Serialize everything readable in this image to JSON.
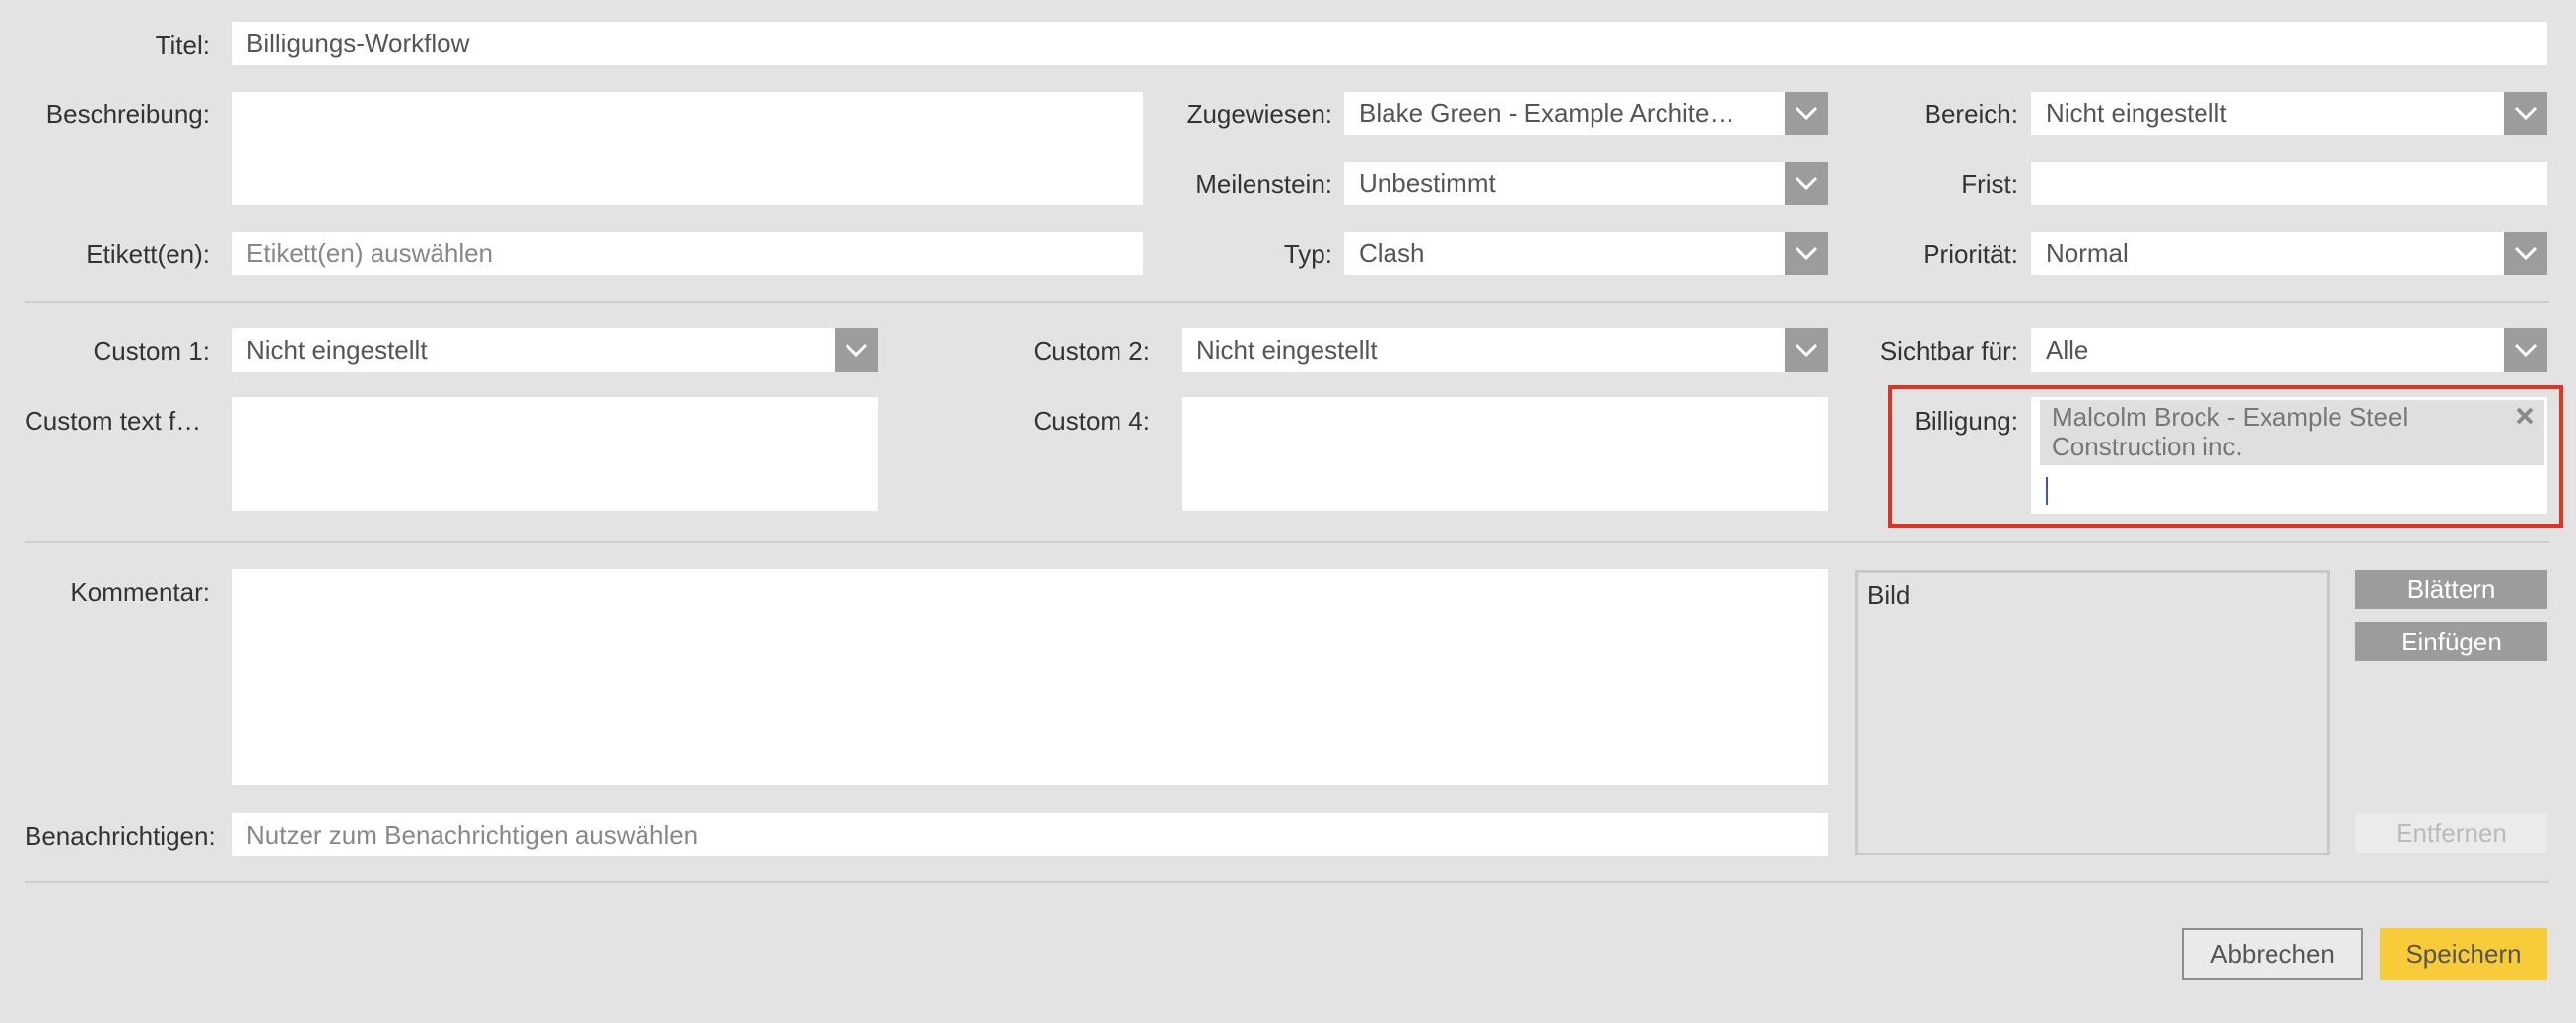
{
  "labels": {
    "title": "Titel:",
    "description": "Beschreibung:",
    "assigned": "Zugewiesen:",
    "area": "Bereich:",
    "milestone": "Meilenstein:",
    "deadline": "Frist:",
    "tags": "Etikett(en):",
    "type": "Typ:",
    "priority": "Priorität:",
    "custom1": "Custom 1:",
    "custom2": "Custom 2:",
    "visible_for": "Sichtbar für:",
    "custom_text": "Custom text f…",
    "custom4": "Custom 4:",
    "approval": "Billigung:",
    "comment": "Kommentar:",
    "notify": "Benachrichtigen:"
  },
  "fields": {
    "title_value": "Billigungs-Workflow",
    "assigned_value": "Blake Green - Example Archite…",
    "area_value": "Nicht eingestellt",
    "milestone_value": "Unbestimmt",
    "deadline_value": "",
    "tags_placeholder": "Etikett(en) auswählen",
    "type_value": "Clash",
    "priority_value": "Normal",
    "custom1_value": "Nicht eingestellt",
    "custom2_value": "Nicht eingestellt",
    "visible_for_value": "Alle",
    "approval_tag": "Malcolm Brock - Example Steel Construction inc.",
    "notify_placeholder": "Nutzer zum Benachrichtigen auswählen"
  },
  "image_panel": {
    "label": "Bild"
  },
  "buttons": {
    "browse": "Blättern",
    "paste": "Einfügen",
    "remove": "Entfernen",
    "cancel": "Abbrechen",
    "save": "Speichern"
  },
  "icons": {
    "dropdown": "chevron-down-icon",
    "remove_tag": "close-icon"
  },
  "colors": {
    "background": "#e4e3e4",
    "highlight_border": "#e23223",
    "save_button": "#f8cb39",
    "dropdown_button": "#9d9c9d"
  }
}
